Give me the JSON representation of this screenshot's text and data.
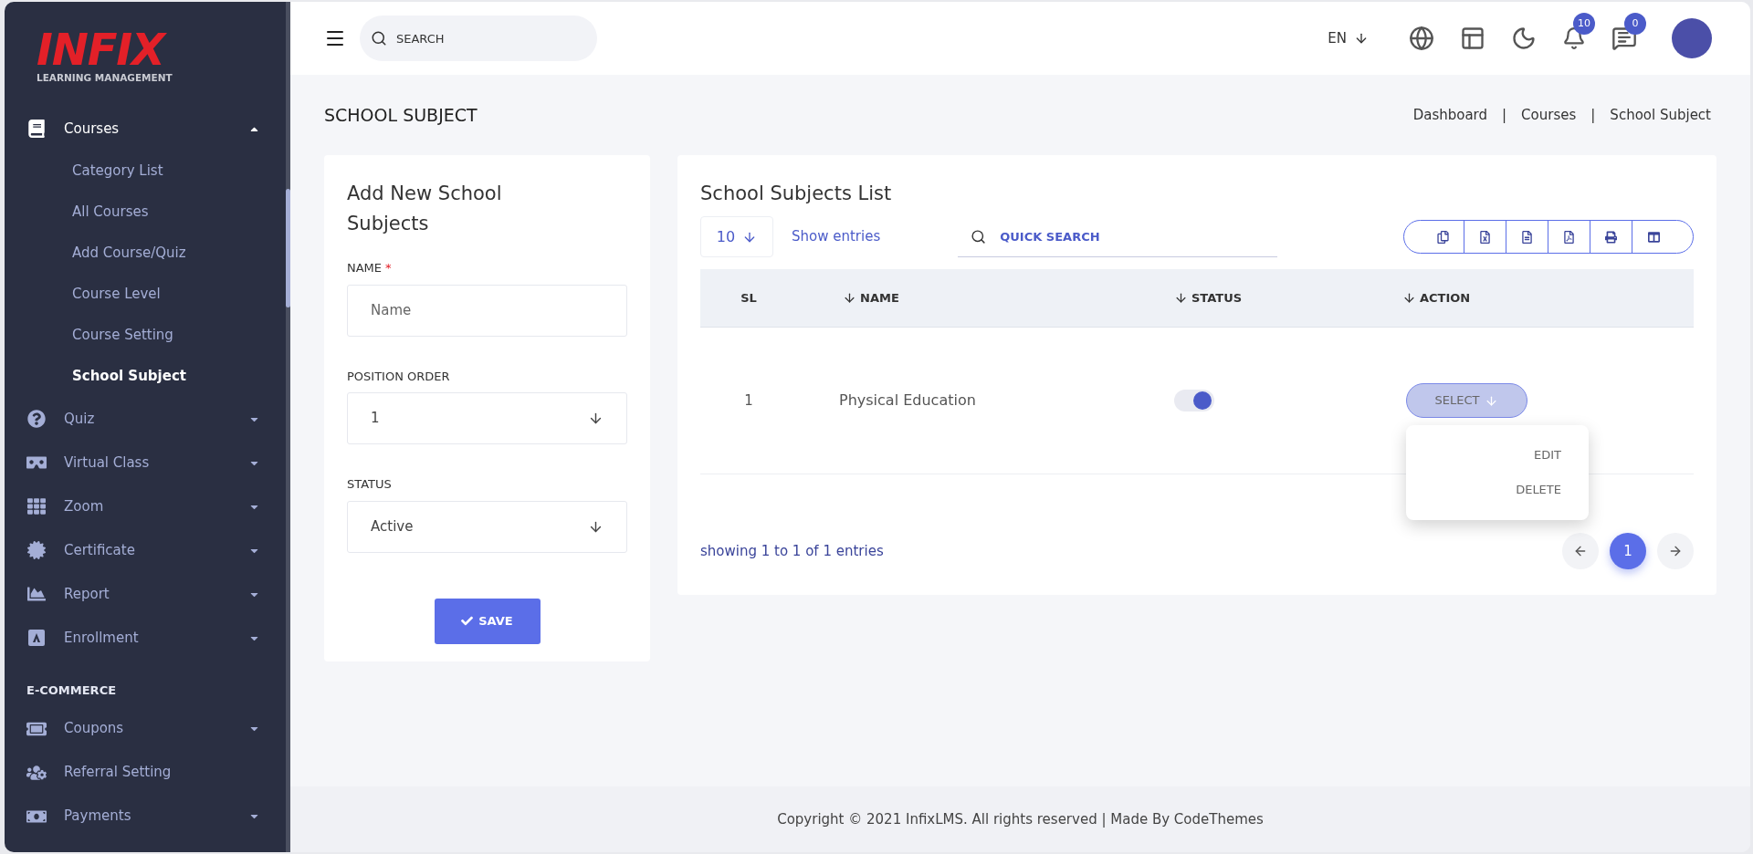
{
  "sidebar": {
    "logo": {
      "text": "INFIX",
      "subtitle": "LEARNING MANAGEMENT"
    },
    "sections": [
      {
        "items": [
          {
            "label": "Courses",
            "expanded": true,
            "children": [
              {
                "label": "Category List",
                "selected": false
              },
              {
                "label": "All Courses",
                "selected": false
              },
              {
                "label": "Add Course/Quiz",
                "selected": false
              },
              {
                "label": "Course Level",
                "selected": false
              },
              {
                "label": "Course Setting",
                "selected": false
              },
              {
                "label": "School Subject",
                "selected": true
              }
            ]
          },
          {
            "label": "Quiz",
            "expanded": false
          },
          {
            "label": "Virtual Class",
            "expanded": false
          },
          {
            "label": "Zoom",
            "expanded": false
          },
          {
            "label": "Certificate",
            "expanded": false
          },
          {
            "label": "Report",
            "expanded": false
          },
          {
            "label": "Enrollment",
            "expanded": false
          }
        ]
      },
      {
        "heading": "E-COMMERCE",
        "items": [
          {
            "label": "Coupons",
            "expanded": false
          },
          {
            "label": "Referral Setting"
          },
          {
            "label": "Payments",
            "expanded": false
          }
        ]
      }
    ]
  },
  "header": {
    "search": {
      "placeholder": "SEARCH"
    },
    "language": "EN",
    "notifications_count": "10",
    "messages_count": "0"
  },
  "page": {
    "title": "SCHOOL SUBJECT",
    "breadcrumbs": [
      "Dashboard",
      "Courses",
      "School Subject"
    ],
    "breadcrumb_separator": "|"
  },
  "form": {
    "title": "Add New School Subjects",
    "fields": [
      {
        "kind": "text",
        "label": "NAME",
        "required_mark": "*",
        "placeholder": "Name"
      },
      {
        "kind": "select",
        "label": "POSITION ORDER",
        "value": "1"
      },
      {
        "kind": "select",
        "label": "STATUS",
        "value": "Active"
      }
    ],
    "save_button": "SAVE"
  },
  "table": {
    "title": "School Subjects List",
    "page_length": "10",
    "show_entries": "Show entries",
    "quick_search": {
      "placeholder": "QUICK SEARCH"
    },
    "columns": [
      {
        "label": "SL",
        "sortable": false
      },
      {
        "label": "NAME",
        "sortable": true
      },
      {
        "label": "STATUS",
        "sortable": true
      },
      {
        "label": "ACTION",
        "sortable": true
      }
    ],
    "rows": [
      {
        "sl": "1",
        "name": "Physical Education",
        "status_on": true,
        "action": "SELECT",
        "menu_open": true
      }
    ],
    "action_menu": [
      "EDIT",
      "DELETE"
    ],
    "info": "showing 1 to 1 of 1 entries",
    "pages": [
      {
        "label": "1",
        "selected": true
      }
    ]
  },
  "footer": {
    "copyright": "Copyright © 2021 InfixLMS. All rights reserved | Made By CodeThemes"
  }
}
